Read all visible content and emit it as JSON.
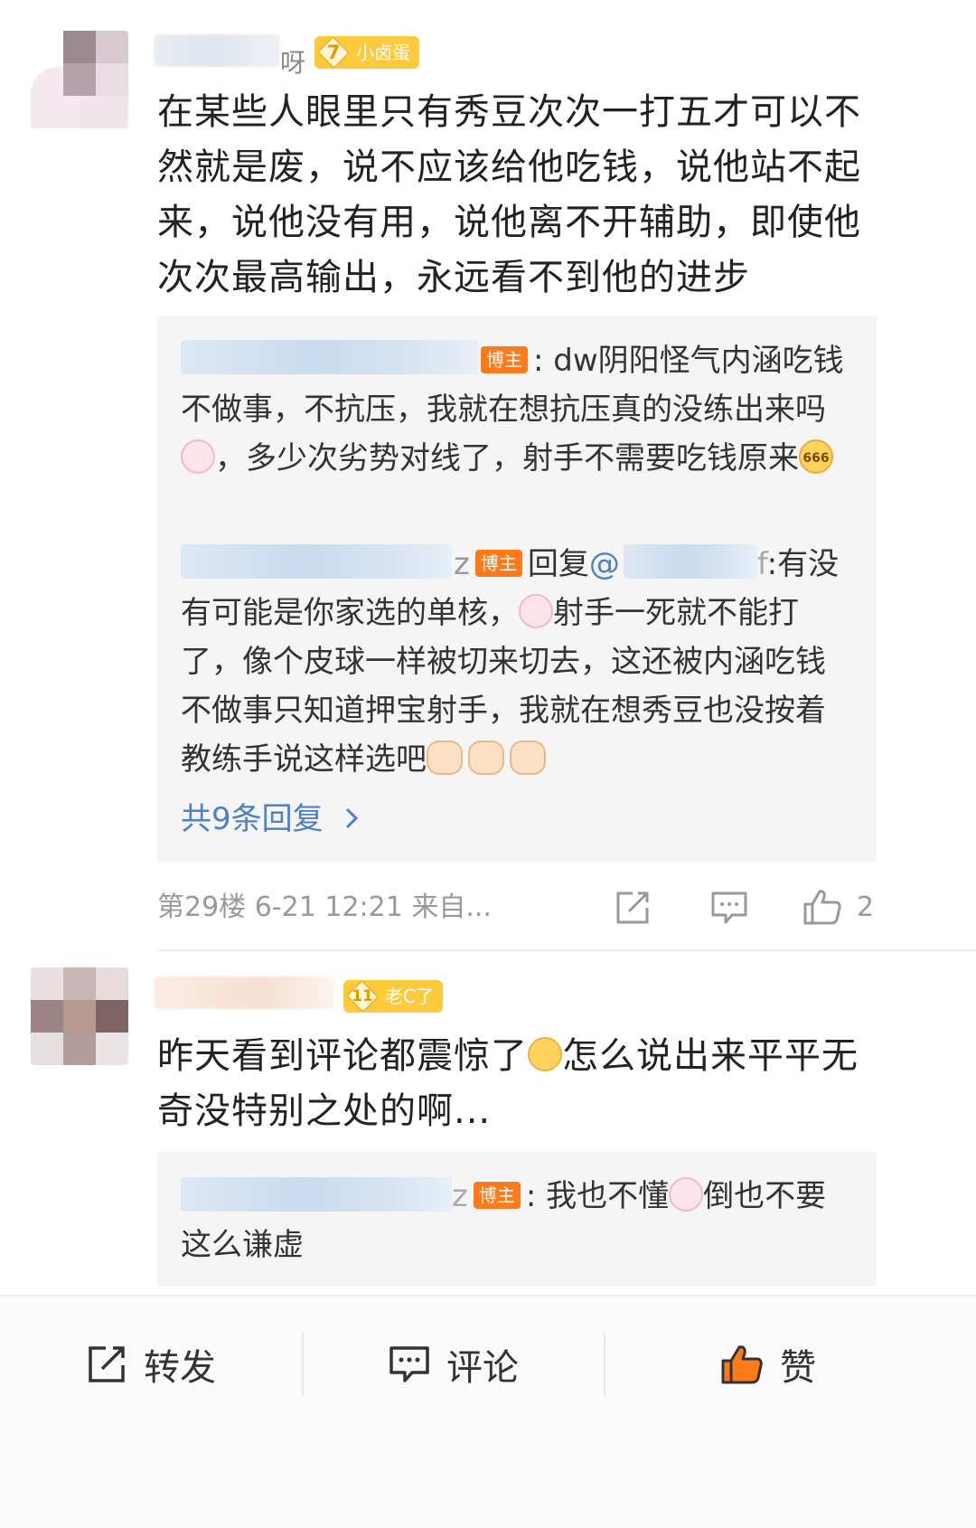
{
  "comments": [
    {
      "username_suffix": "呀",
      "level": "7",
      "level_title": "小卤蛋",
      "text": "在某些人眼里只有秀豆次次一打五才可以不然就是废，说不应该给他吃钱，说他站不起来，说他没有用，说他离不开辅助，即使他次次最高输出，永远看不到他的进步",
      "replies": [
        {
          "author_tag": "博主",
          "separator": ":",
          "text_parts": [
            "dw阴阳怪气内涵吃钱不做事，不抗压，我就在想抗压真的没练出来吗",
            "，多少次劣势对线了，射手不需要吃钱原来"
          ]
        },
        {
          "author_suffix": "z",
          "author_tag": "博主",
          "reply_word": "回复",
          "at_symbol": "@",
          "mention_suffix": "f",
          "text_parts": [
            ":有没有可能是你家选的单核，",
            "射手一死就不能打了，像个皮球一样被切来切去，这还被内涵吃钱不做事只知道押宝射手，我就在想秀豆也没按着教练手说这样选吧"
          ]
        }
      ],
      "more_replies": "共9条回复",
      "meta": "第29楼 6-21 12:21 来自...",
      "like_count": "2"
    },
    {
      "level": "11",
      "level_title": "老C了",
      "text_parts": [
        "昨天看到评论都震惊了",
        "怎么说出来平平无奇没特别之处的啊..."
      ],
      "replies": [
        {
          "author_suffix": "z",
          "author_tag": "博主",
          "separator": ":",
          "text_parts": [
            "我也不懂",
            "倒也不要这么谦虚"
          ]
        }
      ]
    }
  ],
  "emoji_text": {
    "sunglass_label": "666"
  },
  "bottom_bar": {
    "repost": "转发",
    "comment": "评论",
    "like": "赞"
  },
  "colors": {
    "accent_orange": "#ff7a1a",
    "link_blue": "#4c80c7",
    "badge_yellow": "#ffc93c"
  }
}
